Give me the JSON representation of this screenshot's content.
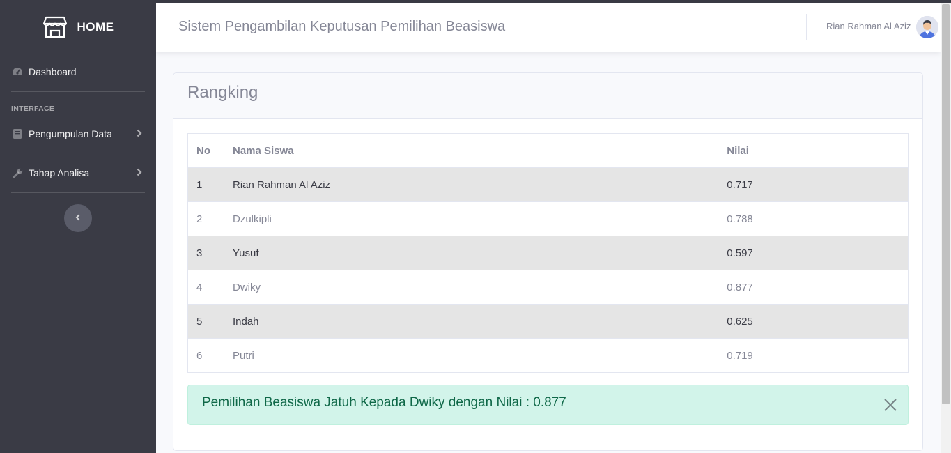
{
  "sidebar": {
    "brand": "HOME",
    "dashboard_label": "Dashboard",
    "heading": "INTERFACE",
    "items": [
      {
        "label": "Pengumpulan Data",
        "icon": "book-icon"
      },
      {
        "label": "Tahap Analisa",
        "icon": "wrench-icon"
      }
    ]
  },
  "topbar": {
    "title": "Sistem Pengambilan Keputusan Pemilihan Beasiswa",
    "user_name": "Rian Rahman Al Aziz"
  },
  "card": {
    "title": "Rangking",
    "table": {
      "headers": [
        "No",
        "Nama Siswa",
        "Nilai"
      ],
      "rows": [
        [
          "1",
          "Rian Rahman Al Aziz",
          "0.717"
        ],
        [
          "2",
          "Dzulkipli",
          "0.788"
        ],
        [
          "3",
          "Yusuf",
          "0.597"
        ],
        [
          "4",
          "Dwiky",
          "0.877"
        ],
        [
          "5",
          "Indah",
          "0.625"
        ],
        [
          "6",
          "Putri",
          "0.719"
        ]
      ]
    },
    "alert": "Pemilihan Beasiswa Jatuh Kepada Dwiky dengan Nilai : 0.877"
  },
  "colors": {
    "sidebar": "#3a3b45",
    "alert_bg": "#d2f4ea",
    "alert_text": "#0f6848",
    "row_striped": "#e5e5e5"
  }
}
